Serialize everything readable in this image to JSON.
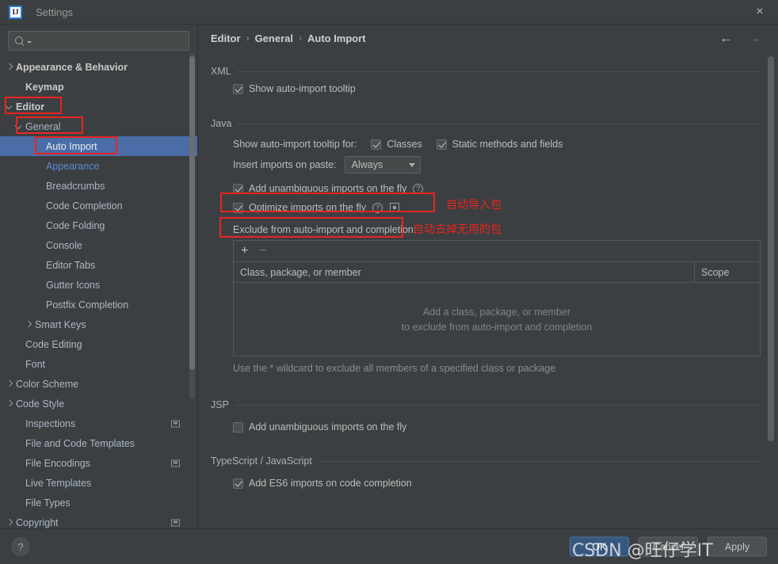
{
  "window": {
    "title": "Settings",
    "logo_text": "IJ",
    "close_icon": "×"
  },
  "sidebar": {
    "search": {
      "value": "",
      "placeholder": ""
    },
    "items": [
      {
        "label": "Appearance & Behavior",
        "arrow": "right",
        "indent": 0,
        "bold": true,
        "selected": false,
        "link": false,
        "badge": false
      },
      {
        "label": "Keymap",
        "arrow": "none",
        "indent": 1,
        "bold": true,
        "selected": false,
        "link": false,
        "badge": false
      },
      {
        "label": "Editor",
        "arrow": "down",
        "indent": 0,
        "bold": true,
        "selected": false,
        "link": false,
        "badge": false
      },
      {
        "label": "General",
        "arrow": "down",
        "indent": 1,
        "bold": false,
        "selected": false,
        "link": false,
        "badge": false
      },
      {
        "label": "Auto Import",
        "arrow": "none",
        "indent": 3,
        "bold": false,
        "selected": true,
        "link": false,
        "badge": false
      },
      {
        "label": "Appearance",
        "arrow": "none",
        "indent": 3,
        "bold": false,
        "selected": false,
        "link": true,
        "badge": false
      },
      {
        "label": "Breadcrumbs",
        "arrow": "none",
        "indent": 3,
        "bold": false,
        "selected": false,
        "link": false,
        "badge": false
      },
      {
        "label": "Code Completion",
        "arrow": "none",
        "indent": 3,
        "bold": false,
        "selected": false,
        "link": false,
        "badge": false
      },
      {
        "label": "Code Folding",
        "arrow": "none",
        "indent": 3,
        "bold": false,
        "selected": false,
        "link": false,
        "badge": false
      },
      {
        "label": "Console",
        "arrow": "none",
        "indent": 3,
        "bold": false,
        "selected": false,
        "link": false,
        "badge": false
      },
      {
        "label": "Editor Tabs",
        "arrow": "none",
        "indent": 3,
        "bold": false,
        "selected": false,
        "link": false,
        "badge": false
      },
      {
        "label": "Gutter Icons",
        "arrow": "none",
        "indent": 3,
        "bold": false,
        "selected": false,
        "link": false,
        "badge": false
      },
      {
        "label": "Postfix Completion",
        "arrow": "none",
        "indent": 3,
        "bold": false,
        "selected": false,
        "link": false,
        "badge": false
      },
      {
        "label": "Smart Keys",
        "arrow": "right",
        "indent": 2,
        "bold": false,
        "selected": false,
        "link": false,
        "badge": false
      },
      {
        "label": "Code Editing",
        "arrow": "none",
        "indent": 1,
        "bold": false,
        "selected": false,
        "link": false,
        "badge": false
      },
      {
        "label": "Font",
        "arrow": "none",
        "indent": 1,
        "bold": false,
        "selected": false,
        "link": false,
        "badge": false
      },
      {
        "label": "Color Scheme",
        "arrow": "right",
        "indent": 0,
        "bold": false,
        "selected": false,
        "link": false,
        "badge": false
      },
      {
        "label": "Code Style",
        "arrow": "right",
        "indent": 0,
        "bold": false,
        "selected": false,
        "link": false,
        "badge": false
      },
      {
        "label": "Inspections",
        "arrow": "none",
        "indent": 1,
        "bold": false,
        "selected": false,
        "link": false,
        "badge": true
      },
      {
        "label": "File and Code Templates",
        "arrow": "none",
        "indent": 1,
        "bold": false,
        "selected": false,
        "link": false,
        "badge": false
      },
      {
        "label": "File Encodings",
        "arrow": "none",
        "indent": 1,
        "bold": false,
        "selected": false,
        "link": false,
        "badge": true
      },
      {
        "label": "Live Templates",
        "arrow": "none",
        "indent": 1,
        "bold": false,
        "selected": false,
        "link": false,
        "badge": false
      },
      {
        "label": "File Types",
        "arrow": "none",
        "indent": 1,
        "bold": false,
        "selected": false,
        "link": false,
        "badge": false
      },
      {
        "label": "Copyright",
        "arrow": "right",
        "indent": 0,
        "bold": false,
        "selected": false,
        "link": false,
        "badge": true
      }
    ]
  },
  "breadcrumb": {
    "item1": "Editor",
    "item2": "General",
    "item3": "Auto Import",
    "sep": "›",
    "back_icon": "←",
    "forward_icon": "→"
  },
  "main": {
    "xml": {
      "group_label": "XML",
      "show_tooltip_label": "Show auto-import tooltip",
      "show_tooltip_checked": true
    },
    "java": {
      "group_label": "Java",
      "tooltip_for_label": "Show auto-import tooltip for:",
      "classes_label": "Classes",
      "classes_checked": true,
      "static_label": "Static methods and fields",
      "static_checked": true,
      "insert_label": "Insert imports on paste:",
      "insert_value": "Always",
      "add_unambiguous_label": "Add unambiguous imports on the fly",
      "add_unambiguous_checked": true,
      "optimize_label": "Optimize imports on the fly",
      "optimize_checked": true,
      "help_icon": "?",
      "exclude_label": "Exclude from auto-import and completion:",
      "toolbar_add": "+",
      "toolbar_remove": "−",
      "col_class": "Class, package, or member",
      "col_scope": "Scope",
      "empty_line1": "Add a class, package, or member",
      "empty_line2": "to exclude from auto-import and completion",
      "hint": "Use the * wildcard to exclude all members of a specified class or package"
    },
    "jsp": {
      "group_label": "JSP",
      "add_unambiguous_label": "Add unambiguous imports on the fly",
      "add_unambiguous_checked": false
    },
    "ts": {
      "group_label": "TypeScript / JavaScript",
      "es6_label": "Add ES6 imports on code completion",
      "es6_checked": true
    }
  },
  "footer": {
    "help_icon": "?",
    "ok_label": "OK",
    "cancel_label": "Cancel",
    "apply_label": "Apply"
  },
  "annotations": {
    "note_add_import": "自动导入包",
    "note_optimize_import": "自动去掉无用的包",
    "box_color": "#e8251f"
  },
  "watermark": {
    "text": "CSDN @旺仔学IT"
  }
}
